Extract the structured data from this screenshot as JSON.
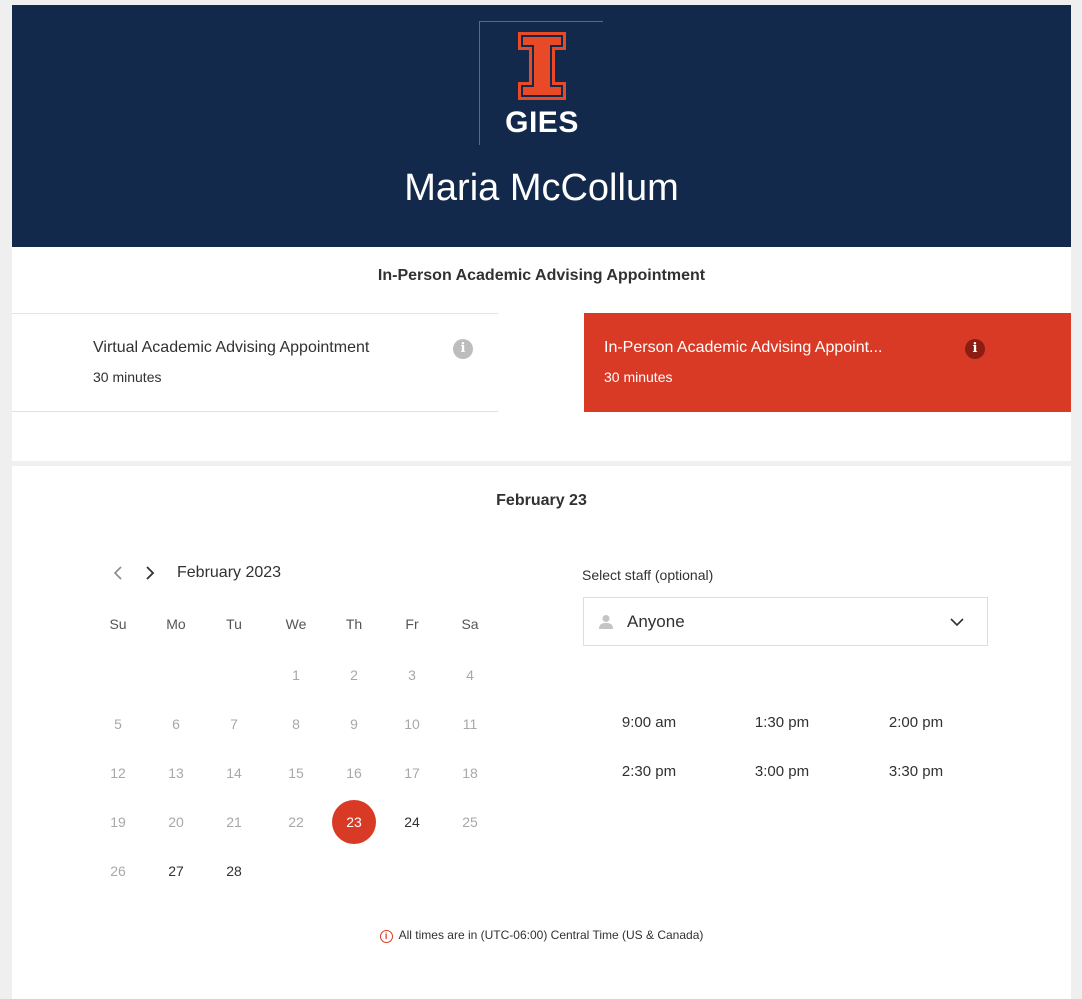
{
  "header": {
    "logo_text": "GIES",
    "staff_name": "Maria McCollum"
  },
  "service_title": "In-Person Academic Advising Appointment",
  "services": [
    {
      "name": "Virtual Academic Advising Appointment",
      "duration": "30 minutes",
      "info": "i"
    },
    {
      "name": "In-Person Academic Advising Appoint...",
      "duration": "30 minutes",
      "info": "i"
    }
  ],
  "selected_date_heading": "February 23",
  "calendar": {
    "month_label": "February 2023",
    "weekdays": [
      "Su",
      "Mo",
      "Tu",
      "We",
      "Th",
      "Fr",
      "Sa"
    ],
    "days": [
      "1",
      "2",
      "3",
      "4",
      "5",
      "6",
      "7",
      "8",
      "9",
      "10",
      "11",
      "12",
      "13",
      "14",
      "15",
      "16",
      "17",
      "18",
      "19",
      "20",
      "21",
      "22",
      "23",
      "24",
      "25",
      "26",
      "27",
      "28"
    ]
  },
  "staff": {
    "label": "Select staff (optional)",
    "value": "Anyone"
  },
  "time_slots": [
    "9:00 am",
    "1:30 pm",
    "2:00 pm",
    "2:30 pm",
    "3:00 pm",
    "3:30 pm"
  ],
  "timezone_note": "All times are in (UTC-06:00) Central Time (US & Canada)",
  "colors": {
    "header_bg": "#13294b",
    "accent": "#d93a26"
  }
}
